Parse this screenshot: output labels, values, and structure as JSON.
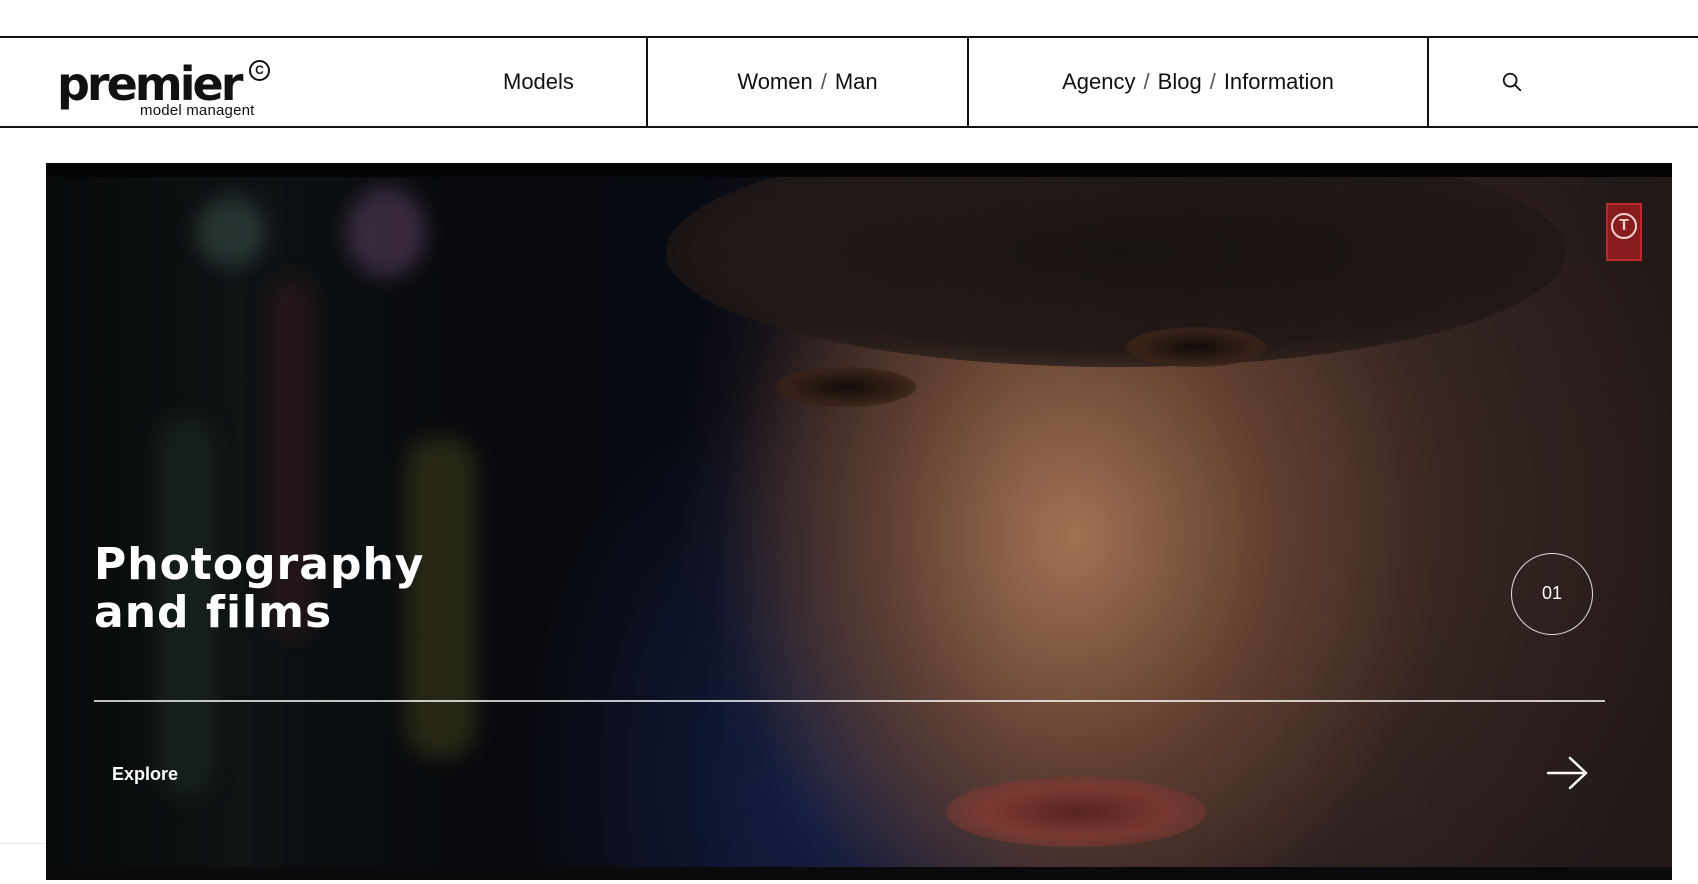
{
  "brand": {
    "name": "premier",
    "copyright_mark": "C",
    "tagline": "model managent"
  },
  "nav": {
    "models": "Models",
    "women": "Women",
    "separator": "/",
    "man": "Man",
    "agency": "Agency",
    "blog": "Blog",
    "information": "Information"
  },
  "hero": {
    "title": "Photography\nand films",
    "slide_number": "01",
    "explore_label": "Explore",
    "channel_badge": "T"
  },
  "icons": {
    "search": "search-icon",
    "arrow": "arrow-right-icon"
  },
  "colors": {
    "text": "#111111",
    "hero_text": "#ffffff",
    "badge": "#c0282a"
  }
}
